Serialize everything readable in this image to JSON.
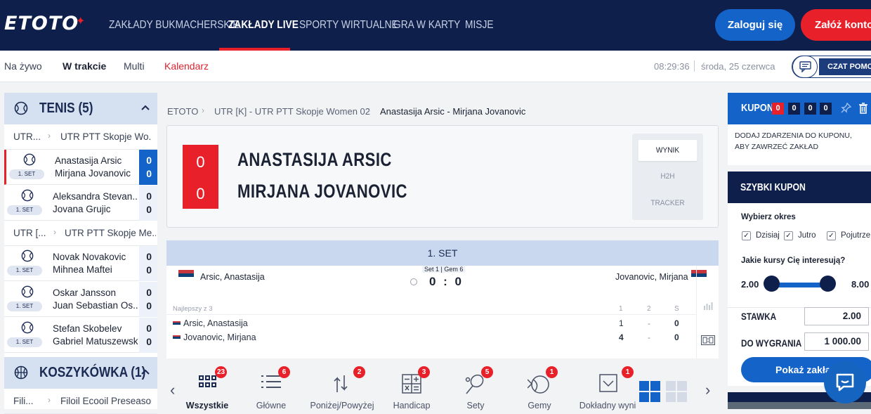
{
  "header": {
    "logo": "ETOTO",
    "nav": [
      "ZAKŁADY BUKMACHERSKIE",
      "ZAKŁADY LIVE",
      "SPORTY WIRTUALNE",
      "GRA W KARTY",
      "MISJE"
    ],
    "active_nav": "ZAKŁADY LIVE",
    "login": "Zaloguj się",
    "register": "Załóż konto"
  },
  "subnav": {
    "items": [
      "Na żywo",
      "W trakcie",
      "Multi",
      "Kalendarz"
    ],
    "active": "W trakcie",
    "time": "08:29:36",
    "date": "środa, 25 czerwca",
    "chat": "CZAT POMOCY"
  },
  "sidebar": {
    "tennis": {
      "title": "TENIS",
      "count": "(5)"
    },
    "leagues": [
      {
        "short": "UTR...",
        "name": "UTR PTT Skopje Wo..."
      },
      {
        "short": "UTR [...",
        "name": "UTR PTT Skopje Me..."
      }
    ],
    "matches": [
      {
        "p1": "Anastasija Arsic",
        "p2": "Mirjana Jovanovic",
        "s1": "0",
        "s2": "0",
        "badge": "1. SET"
      },
      {
        "p1": "Aleksandra Stevan...",
        "p2": "Jovana Grujic",
        "s1": "0",
        "s2": "0",
        "badge": "1. SET"
      },
      {
        "p1": "Novak Novakovic",
        "p2": "Mihnea Maftei",
        "s1": "0",
        "s2": "0",
        "badge": "1. SET"
      },
      {
        "p1": "Oskar Jansson",
        "p2": "Juan Sebastian Os...",
        "s1": "0",
        "s2": "0",
        "badge": "1. SET"
      },
      {
        "p1": "Stefan Skobelev",
        "p2": "Gabriel Matuszewski",
        "s1": "0",
        "s2": "0",
        "badge": "1. SET"
      }
    ],
    "basketball": {
      "title": "KOSZYKÓWKA",
      "count": "(1)",
      "league_short": "Fili...",
      "league": "Filoil Ecooil Preseason ..."
    }
  },
  "breadcrumb": [
    "ETOTO",
    "UTR [K] - UTR PTT Skopje Women 02",
    "Anastasija Arsic - Mirjana Jovanovic"
  ],
  "scoreboard": {
    "p1": "ANASTASIJA ARSIC",
    "p2": "MIRJANA JOVANOVIC",
    "s1": "0",
    "s2": "0",
    "tabs": [
      "WYNIK",
      "H2H",
      "TRACKER"
    ]
  },
  "live": {
    "set_title": "1. SET",
    "left_name": "Arsic, Anastasija",
    "right_name": "Jovanovic, Mirjana",
    "set_info": "Set 1 | Gem 6",
    "score": "0 : 0",
    "best_of": "Najlepszy z 3",
    "cols": [
      "1",
      "2",
      "S"
    ],
    "rows": [
      {
        "name": "Arsic, Anastasija",
        "c1": "1",
        "c2": "-",
        "s": "0"
      },
      {
        "name": "Jovanovic, Mirjana",
        "c1": "4",
        "c2": "-",
        "s": "0"
      }
    ]
  },
  "markets": [
    {
      "label": "Wszystkie",
      "count": "23"
    },
    {
      "label": "Główne",
      "count": "6"
    },
    {
      "label": "Poniżej/Powyżej",
      "count": "2"
    },
    {
      "label": "Handicap",
      "count": "3"
    },
    {
      "label": "Sety",
      "count": "5"
    },
    {
      "label": "Gemy",
      "count": "1"
    },
    {
      "label": "Dokładny wyni",
      "count": "1"
    }
  ],
  "coupon": {
    "title": "KUPON",
    "counts": [
      "0",
      "0",
      "0",
      "0"
    ],
    "info": "DODAJ ZDARZENIA DO KUPONU, ABY ZAWRZEĆ ZAKŁAD",
    "quick_title": "SZYBKI KUPON",
    "period_label": "Wybierz okres",
    "periods": [
      "Dzisiaj",
      "Jutro",
      "Pojutrze"
    ],
    "odds_label": "Jakie kursy Cię interesują?",
    "odds_min": "2.00",
    "odds_max": "8.00",
    "stake_label": "STAWKA",
    "stake": "2.00",
    "win_label": "DO WYGRANIA",
    "win": "1 000.00",
    "show_button": "Pokaż zakłady"
  }
}
